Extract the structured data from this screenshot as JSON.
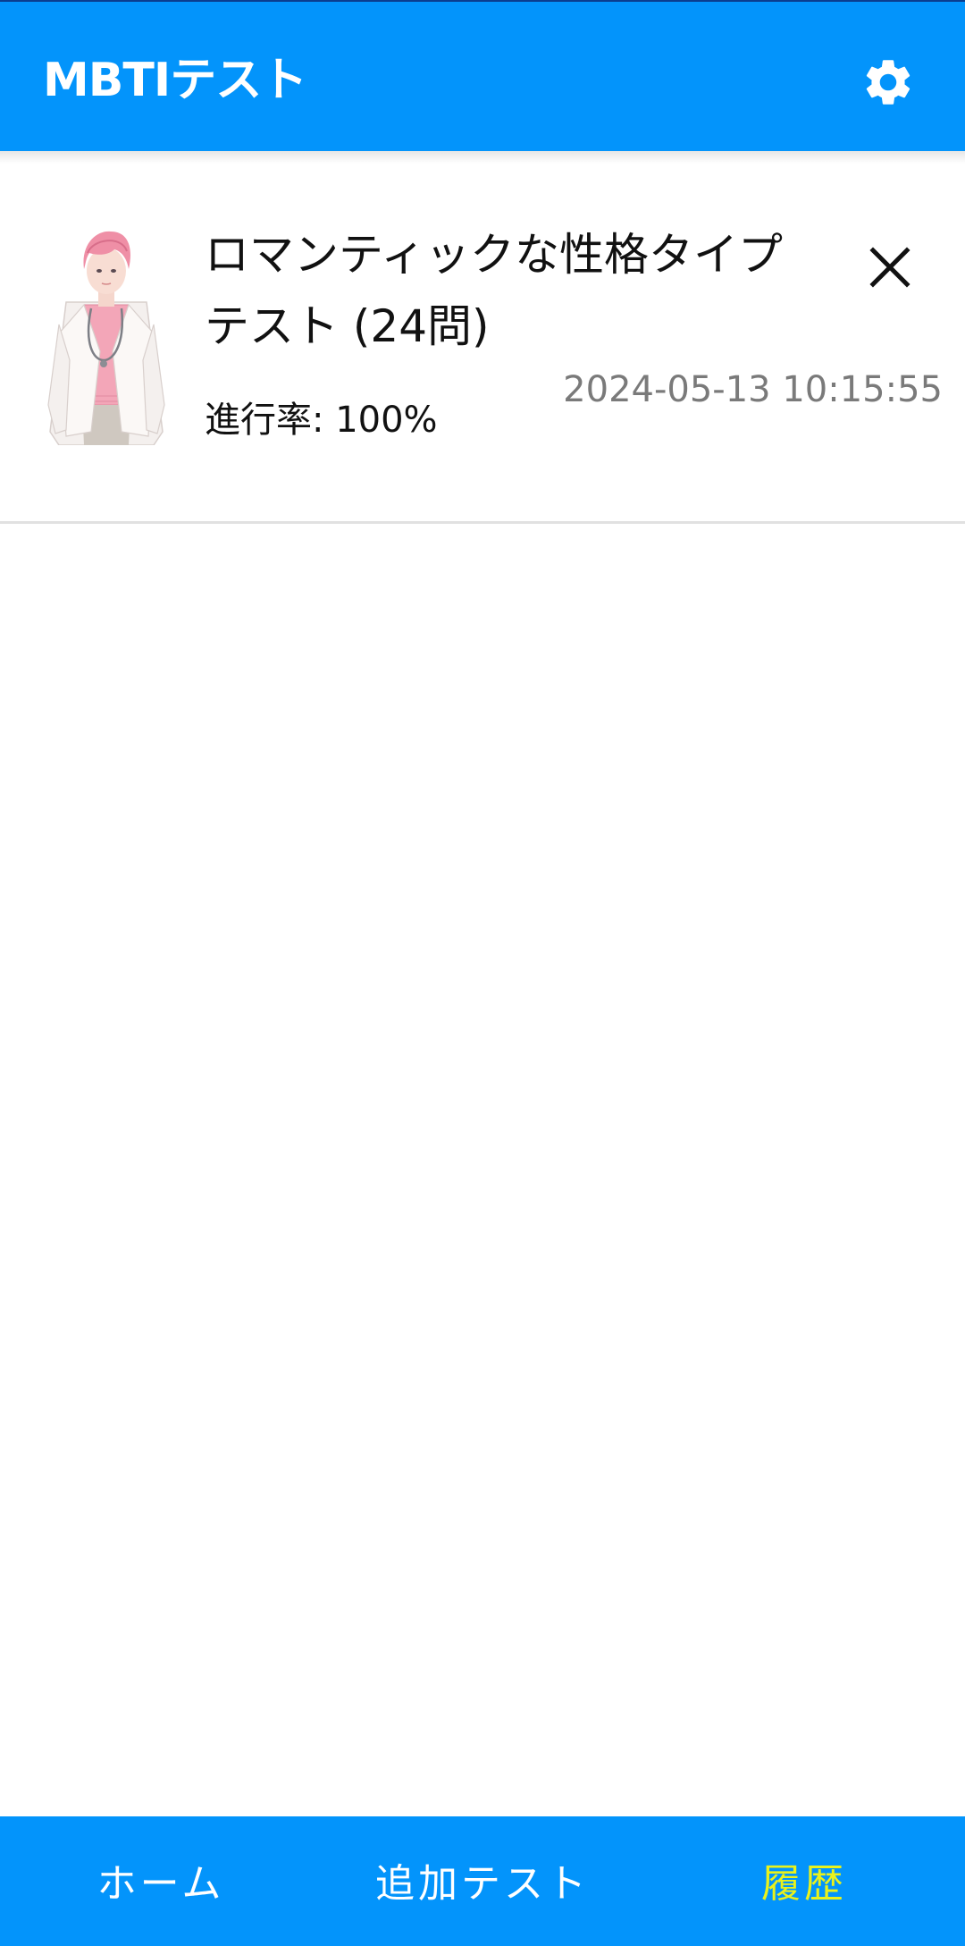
{
  "appbar": {
    "title": "MBTIテスト",
    "settings_icon": "gear-icon",
    "color": "#0394fb"
  },
  "history": {
    "items": [
      {
        "title": "ロマンティックな性格タイプテスト (24問)",
        "progress_text": "進行率: 100%",
        "progress": 1.0,
        "datetime": "2024-05-13 10:15:55",
        "thumbnail": "pink-haired-doctor-character",
        "close_icon": "close-icon"
      }
    ]
  },
  "bottom_nav": {
    "home_label": "ホーム",
    "add_tests_label": "追加テスト",
    "history_label": "履歴",
    "active": "history",
    "active_color": "#e9f21b"
  }
}
